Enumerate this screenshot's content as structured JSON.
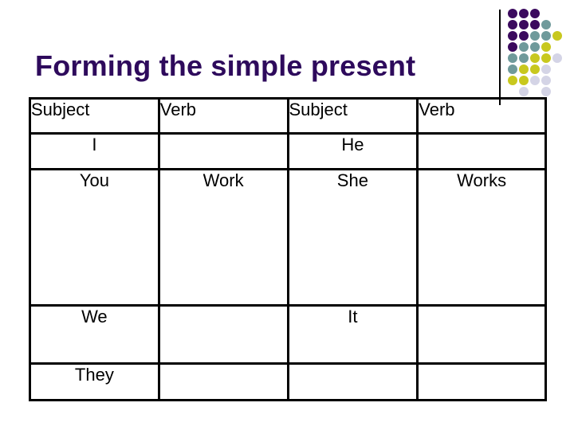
{
  "slide": {
    "title": "Forming the simple present",
    "colors": {
      "title": "#2E0A5C",
      "header_text": "#C00000",
      "verb_text": "#22B02A",
      "dot_purple": "#3B0A5E",
      "dot_teal": "#6F9A9B",
      "dot_yellow": "#C8C81E",
      "dot_lavender": "#D4D4E6"
    },
    "decoration": {
      "dot_rows": [
        [
          "purple",
          "purple",
          "purple",
          null,
          null
        ],
        [
          "purple",
          "purple",
          "purple",
          "teal",
          null
        ],
        [
          "purple",
          "purple",
          "teal",
          "teal",
          "yellow"
        ],
        [
          "purple",
          "teal",
          "teal",
          "yellow",
          null
        ],
        [
          "teal",
          "teal",
          "yellow",
          "yellow",
          "lavender"
        ],
        [
          "teal",
          "yellow",
          "yellow",
          "lavender",
          null
        ],
        [
          "yellow",
          "yellow",
          "lavender",
          "lavender",
          null
        ],
        [
          null,
          "lavender",
          null,
          "lavender",
          null
        ]
      ]
    },
    "table": {
      "headers": [
        "Subject",
        "Verb",
        "Subject",
        "Verb"
      ],
      "rows": [
        {
          "subject1": "I",
          "verb1": "",
          "subject2": "He",
          "verb2": ""
        },
        {
          "subject1": "You",
          "verb1": "Work",
          "subject2": "She",
          "verb2": "Works"
        },
        {
          "subject1": "We",
          "verb1": "",
          "subject2": "It",
          "verb2": ""
        },
        {
          "subject1": "They",
          "verb1": "",
          "subject2": "",
          "verb2": ""
        }
      ]
    }
  }
}
